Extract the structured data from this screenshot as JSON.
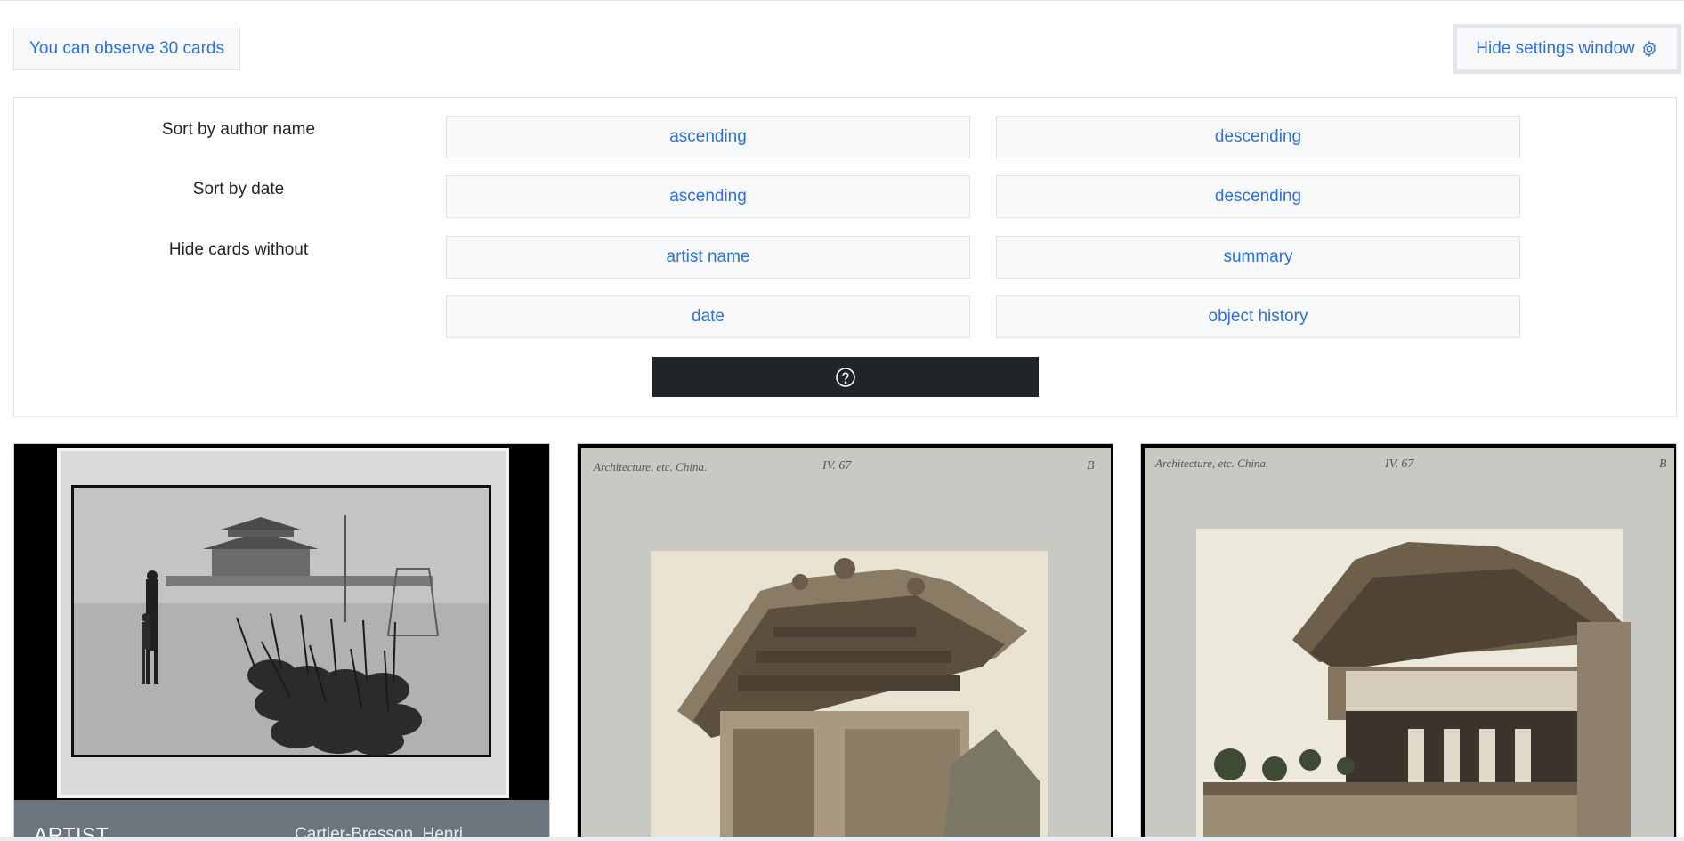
{
  "header": {
    "card_count_text": "You can observe 30 cards",
    "settings_toggle_label": "Hide settings window"
  },
  "settings": {
    "sort_author": {
      "label": "Sort by author name",
      "ascending": "ascending",
      "descending": "descending"
    },
    "sort_date": {
      "label": "Sort by date",
      "ascending": "ascending",
      "descending": "descending"
    },
    "hide_without": {
      "label": "Hide cards without",
      "options": [
        "artist name",
        "summary",
        "date",
        "object history"
      ]
    }
  },
  "cards": [
    {
      "field_label": "ARTIST",
      "field_value": "Cartier-Bresson, Henri"
    },
    {
      "inscription_left": "Architecture, etc. China.",
      "inscription_center": "IV. 67",
      "inscription_right": "B"
    },
    {
      "inscription_left": "Architecture, etc. China.",
      "inscription_center": "IV. 67",
      "inscription_right": "B"
    }
  ],
  "icons": {
    "settings": "gear-icon",
    "help": "question-circle-icon"
  },
  "colors": {
    "link": "#2f6fd8",
    "dark_button": "#212529",
    "card_footer": "#6c757d"
  }
}
